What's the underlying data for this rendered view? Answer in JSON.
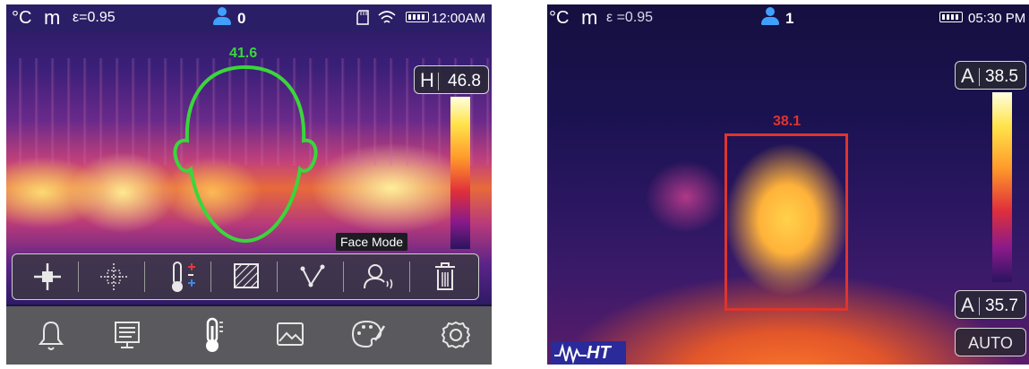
{
  "left_screen": {
    "status": {
      "unit": "°C",
      "mode": "m",
      "emissivity": "ε=0.95",
      "person_count": "0",
      "time": "12:00AM",
      "icons": [
        "person-icon",
        "sd-card-icon",
        "wifi-icon",
        "battery-icon"
      ]
    },
    "face_temp": "41.6",
    "high_box": {
      "label": "H",
      "value": "46.8"
    },
    "tooltip": "Face Mode",
    "toolbar": [
      "crosshair-icon",
      "center-point-icon",
      "thermometer-marks-icon",
      "area-box-icon",
      "line-profile-icon",
      "face-mode-icon",
      "trash-icon"
    ],
    "menu": [
      "bell-icon",
      "display-icon",
      "thermometer-icon",
      "image-icon",
      "palette-icon",
      "settings-gear-icon"
    ]
  },
  "right_screen": {
    "status": {
      "unit": "°C",
      "mode": "m",
      "emissivity": "ε =0.95",
      "person_count": "1",
      "time": "05:30 PM",
      "icons": [
        "person-icon",
        "battery-icon"
      ]
    },
    "face_temp": "38.1",
    "high_box": {
      "label": "A",
      "value": "38.5"
    },
    "low_box": {
      "label": "A",
      "value": "35.7"
    },
    "auto_label": "AUTO",
    "brand": "HT",
    "colors": {
      "face_box": "#e0342c",
      "face_temp": "#e0342c",
      "face_outline": "#3ad63a",
      "person_icon": "#3fa0ff"
    }
  }
}
